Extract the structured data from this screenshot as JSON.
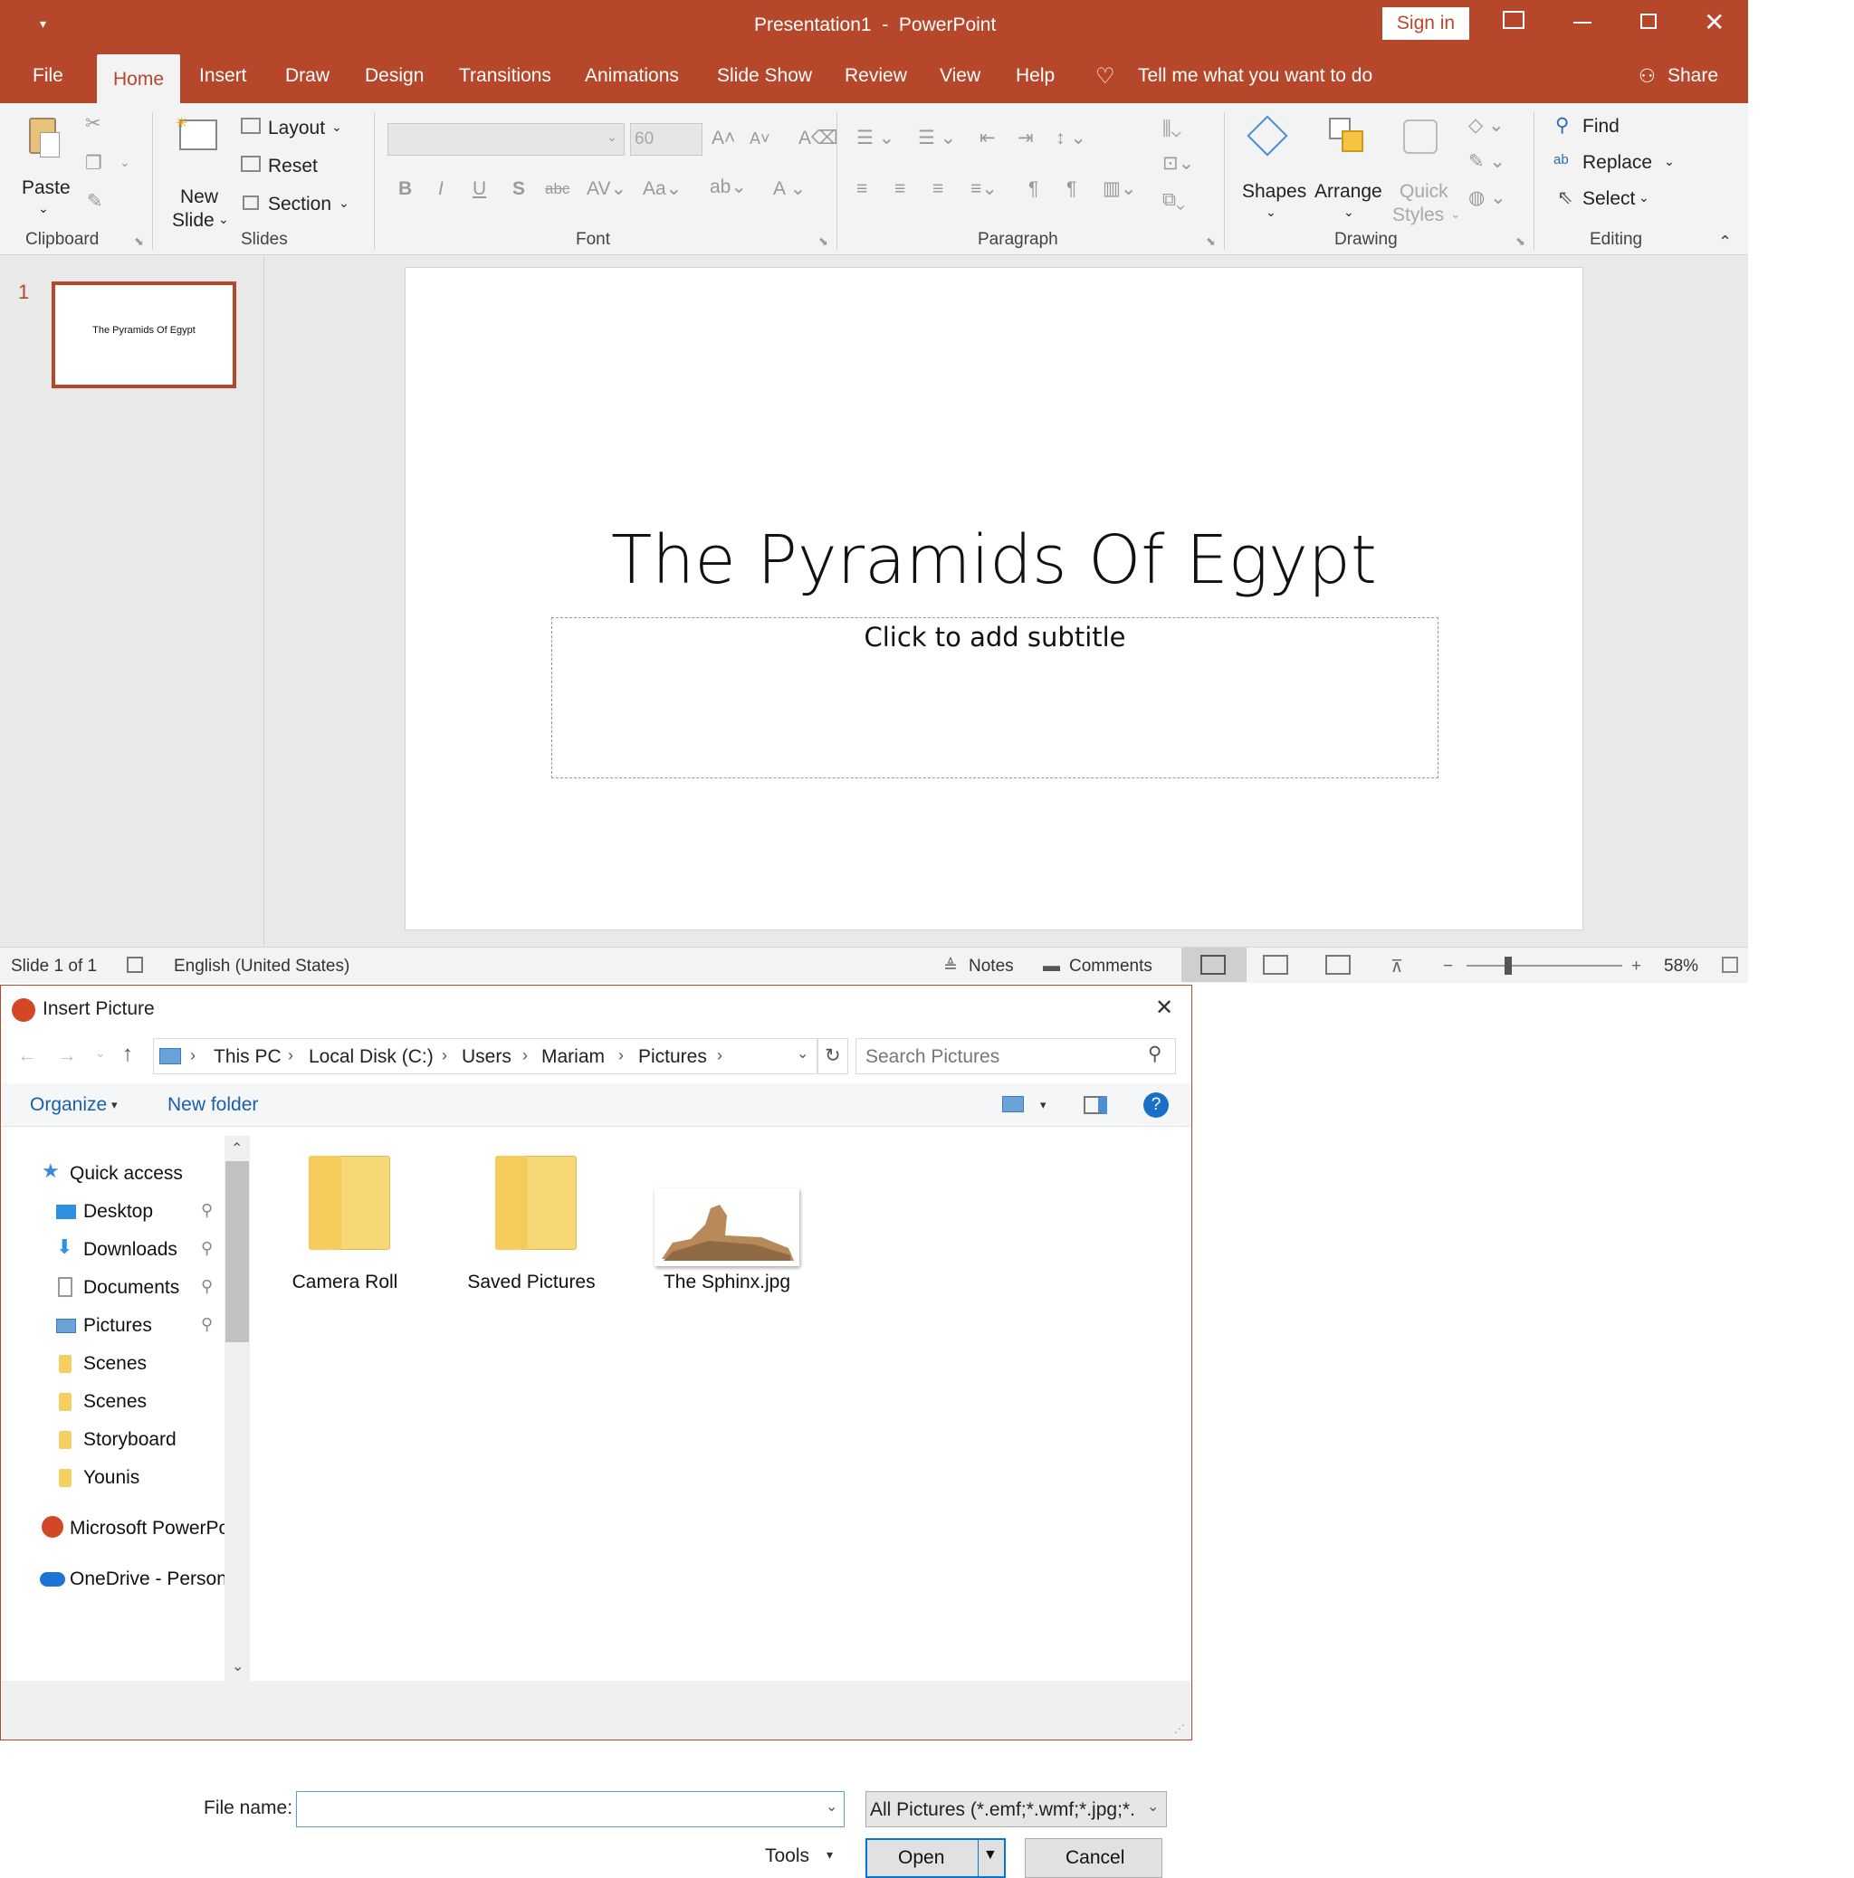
{
  "titlebar": {
    "title": "Presentation1  -  PowerPoint",
    "signin": "Sign in"
  },
  "tabs": [
    "File",
    "Home",
    "Insert",
    "Draw",
    "Design",
    "Transitions",
    "Animations",
    "Slide Show",
    "Review",
    "View",
    "Help"
  ],
  "tell_me": "Tell me what you want to do",
  "share": "Share",
  "ribbon": {
    "paste": "Paste",
    "clipboard": "Clipboard",
    "new_slide_1": "New",
    "new_slide_2": "Slide",
    "layout": "Layout",
    "reset": "Reset",
    "section": "Section",
    "slides": "Slides",
    "font_size": "60",
    "font": "Font",
    "paragraph": "Paragraph",
    "shapes": "Shapes",
    "arrange": "Arrange",
    "quick_1": "Quick",
    "quick_2": "Styles",
    "drawing": "Drawing",
    "find": "Find",
    "replace": "Replace",
    "select": "Select",
    "editing": "Editing"
  },
  "thumbnail": {
    "number": "1",
    "title": "The Pyramids Of Egypt"
  },
  "slide": {
    "title": "The Pyramids Of Egypt",
    "subtitle_placeholder": "Click to add subtitle"
  },
  "status": {
    "slide": "Slide 1 of 1",
    "language": "English (United States)",
    "notes": "Notes",
    "comments": "Comments",
    "zoom": "58%"
  },
  "dialog": {
    "title": "Insert Picture",
    "breadcrumb": [
      "This PC",
      "Local Disk (C:)",
      "Users",
      "Mariam",
      "Pictures"
    ],
    "search_placeholder": "Search Pictures",
    "organize": "Organize",
    "new_folder": "New folder",
    "nav": {
      "quick_access": "Quick access",
      "items": [
        "Desktop",
        "Downloads",
        "Documents",
        "Pictures",
        "Scenes",
        "Scenes",
        "Storyboard",
        "Younis"
      ],
      "powerpoint": "Microsoft PowerPo",
      "onedrive": "OneDrive - Person"
    },
    "files": [
      "Camera Roll",
      "Saved Pictures",
      "The Sphinx.jpg"
    ],
    "file_name_label": "File name:",
    "file_name_value": "",
    "filter": "All Pictures (*.emf;*.wmf;*.jpg;*.",
    "tools": "Tools",
    "open": "Open",
    "cancel": "Cancel"
  },
  "colors": {
    "accent": "#b7472a",
    "folder": "#f5cf62",
    "link_blue": "#1a5fa8"
  }
}
